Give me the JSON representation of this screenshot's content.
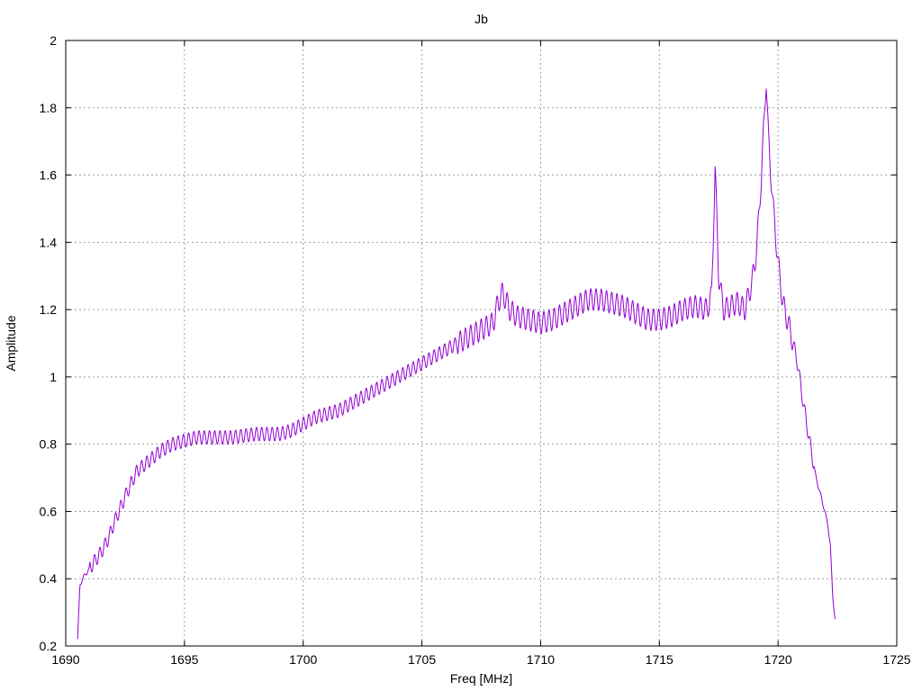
{
  "chart_data": {
    "type": "line",
    "title": "Jb",
    "xlabel": "Freq [MHz]",
    "ylabel": "Amplitude",
    "xlim": [
      1690,
      1725
    ],
    "ylim": [
      0.2,
      2
    ],
    "xticks": [
      1690,
      1695,
      1700,
      1705,
      1710,
      1715,
      1720,
      1725
    ],
    "yticks": [
      0.2,
      0.4,
      0.6,
      0.8,
      1,
      1.2,
      1.4,
      1.6,
      1.8,
      2
    ],
    "grid": true,
    "colors": {
      "series": "#9400d3",
      "grid": "#a0a0a0",
      "axis": "#000000"
    },
    "series": [
      {
        "x": [
          1690.5,
          1690.6,
          1690.7,
          1690.8,
          1691.0,
          1691.2,
          1691.5,
          1691.8,
          1692.0,
          1692.3,
          1692.6,
          1693.0,
          1693.5,
          1694.0,
          1694.5,
          1695.0,
          1695.5,
          1696.0,
          1697.0,
          1698.0,
          1699.0,
          1699.5,
          1700.0,
          1700.5,
          1701.0,
          1701.5,
          1702.0,
          1702.5,
          1703.0,
          1703.5,
          1704.0,
          1704.5,
          1705.0,
          1705.5,
          1706.0,
          1706.5,
          1707.0,
          1707.5,
          1708.0,
          1708.2,
          1708.4,
          1708.7,
          1709.0,
          1709.5,
          1710.0,
          1710.5,
          1711.0,
          1711.5,
          1712.0,
          1712.5,
          1713.0,
          1713.5,
          1714.0,
          1714.5,
          1715.0,
          1715.5,
          1716.0,
          1716.5,
          1717.0,
          1717.2,
          1717.35,
          1717.5,
          1717.7,
          1718.0,
          1718.3,
          1718.6,
          1718.9,
          1719.1,
          1719.3,
          1719.5,
          1719.6,
          1719.8,
          1720.0,
          1720.2,
          1720.5,
          1720.8,
          1721.0,
          1721.3,
          1721.6,
          1721.9,
          1722.1,
          1722.2,
          1722.3,
          1722.4
        ],
        "y": [
          0.22,
          0.38,
          0.4,
          0.41,
          0.43,
          0.45,
          0.48,
          0.52,
          0.56,
          0.61,
          0.66,
          0.72,
          0.75,
          0.78,
          0.8,
          0.81,
          0.82,
          0.82,
          0.82,
          0.83,
          0.83,
          0.84,
          0.86,
          0.88,
          0.89,
          0.9,
          0.92,
          0.94,
          0.96,
          0.98,
          1.0,
          1.02,
          1.04,
          1.06,
          1.08,
          1.1,
          1.12,
          1.14,
          1.16,
          1.22,
          1.25,
          1.2,
          1.18,
          1.17,
          1.16,
          1.17,
          1.19,
          1.21,
          1.23,
          1.23,
          1.22,
          1.21,
          1.19,
          1.17,
          1.17,
          1.18,
          1.2,
          1.21,
          1.2,
          1.24,
          1.62,
          1.3,
          1.2,
          1.21,
          1.22,
          1.2,
          1.28,
          1.38,
          1.6,
          1.89,
          1.7,
          1.5,
          1.34,
          1.22,
          1.14,
          1.05,
          0.95,
          0.82,
          0.7,
          0.62,
          0.56,
          0.5,
          0.35,
          0.28
        ],
        "ripple_amplitude": 0.02
      }
    ]
  }
}
